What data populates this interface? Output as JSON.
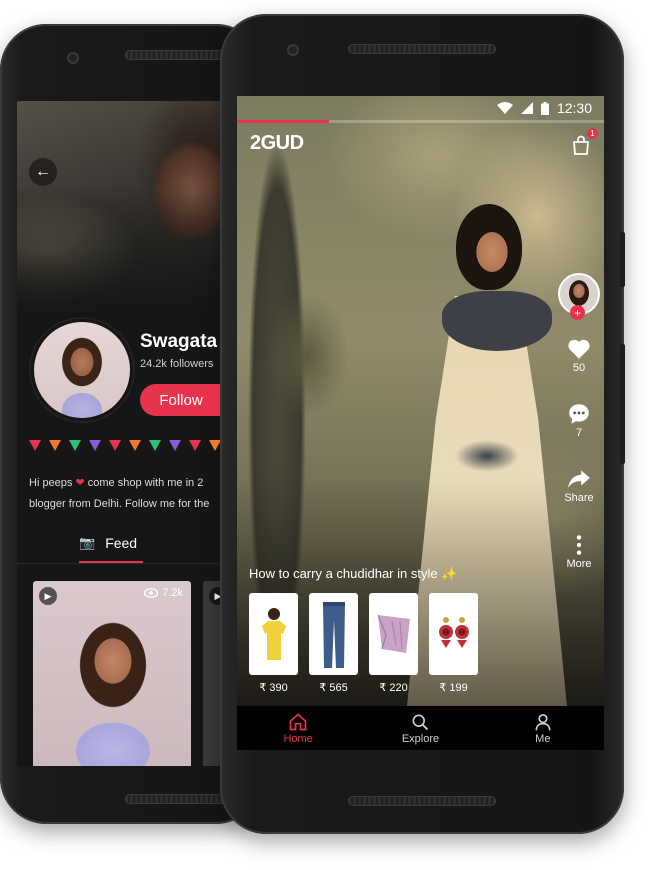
{
  "back_screen": {
    "profile": {
      "name": "Swagata",
      "followers": "24.2k followers",
      "follow_label": "Follow"
    },
    "bunting_colors": [
      "#e8334f",
      "#f07a2a",
      "#2fbf7a",
      "#8a5cd8",
      "#e8334f",
      "#f07a2a",
      "#2fbf7a",
      "#8a5cd8",
      "#e8334f",
      "#f07a2a"
    ],
    "bio_line1_a": "Hi peeps",
    "bio_line1_b": "come shop with me in 2",
    "bio_line2": "blogger from Delhi. Follow me for the",
    "feed_tab_label": "Feed",
    "video_views": "7.2k"
  },
  "front_screen": {
    "status_time": "12:30",
    "brand": "2GUD",
    "cart_count": "1",
    "video_progress": 0.25,
    "rail": {
      "likes": "50",
      "comments": "7",
      "share_label": "Share",
      "more_label": "More"
    },
    "caption": "How to carry a chudidhar in style ✨",
    "products": [
      {
        "name": "yellow-tshirt",
        "price": "₹ 390",
        "color": "#f2d23c"
      },
      {
        "name": "jeans",
        "price": "₹ 565",
        "color": "#3e5c8a"
      },
      {
        "name": "scarf",
        "price": "₹ 220",
        "color": "#c9a3c6"
      },
      {
        "name": "earrings",
        "price": "₹ 199",
        "color": "#c0303b"
      }
    ],
    "nav": [
      {
        "label": "Home",
        "icon": "home-icon",
        "active": true
      },
      {
        "label": "Explore",
        "icon": "search-icon",
        "active": false
      },
      {
        "label": "Me",
        "icon": "person-icon",
        "active": false
      }
    ]
  },
  "colors": {
    "accent": "#e8334f"
  }
}
